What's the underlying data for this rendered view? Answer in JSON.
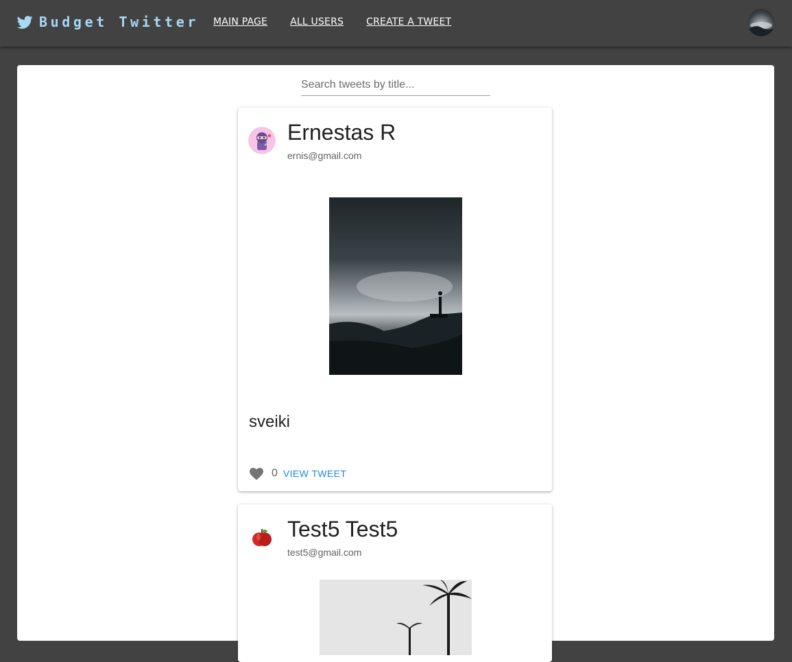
{
  "app": {
    "brand": "Budget Twitter",
    "nav": [
      "MAIN PAGE",
      "ALL USERS",
      "CREATE A TWEET"
    ]
  },
  "search": {
    "placeholder": "Search tweets by title..."
  },
  "tweets": [
    {
      "author_name": "Ernestas R",
      "author_email": "ernis@gmail.com",
      "title": "sveiki",
      "likes": "0",
      "view_label": "VIEW TWEET",
      "avatar_icon": "ninja-avatar-icon",
      "image_icon": "mountain-silhouette-image"
    },
    {
      "author_name": "Test5 Test5",
      "author_email": "test5@gmail.com",
      "avatar_icon": "apple-avatar-icon",
      "image_icon": "palm-trees-image"
    }
  ],
  "colors": {
    "appbar": "#424242",
    "brand": "#a7d8f5",
    "link": "#1e88e5",
    "heart": "#757575"
  }
}
